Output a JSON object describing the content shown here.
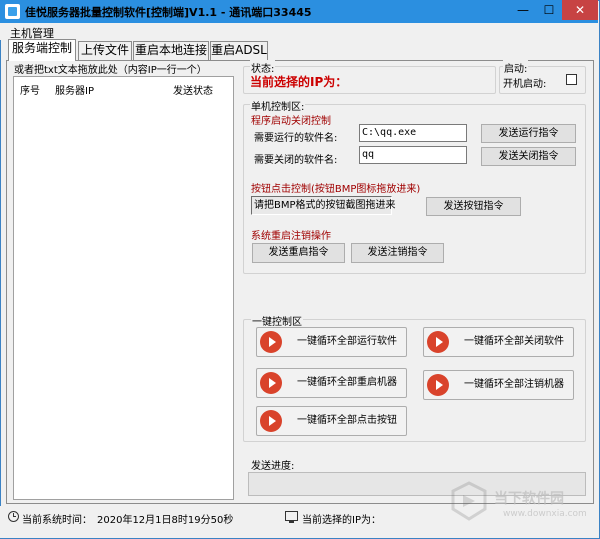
{
  "window": {
    "title": "佳悦服务器批量控制软件[控制端]V1.1 - 通讯端口33445",
    "minimize_glyph": "—",
    "maximize_glyph": "☐",
    "close_glyph": "✕"
  },
  "menu": {
    "items": [
      {
        "label": "主机管理"
      }
    ]
  },
  "tabs": [
    {
      "label": "服务端控制",
      "selected": true
    },
    {
      "label": "上传文件",
      "selected": false
    },
    {
      "label": "重启本地连接",
      "selected": false
    },
    {
      "label": "重启ADSL",
      "selected": false
    }
  ],
  "left_panel": {
    "hint": "或者把txt文本拖放此处（内容IP一行一个）",
    "columns": [
      "序号",
      "服务器IP",
      "发送状态"
    ]
  },
  "status_group": {
    "label": "状态:",
    "current_ip_text": "当前选择的IP为："
  },
  "startup_group": {
    "label": "启动:",
    "autostart_label": "开机启动:",
    "autostart_checked": false
  },
  "single_control": {
    "label": "单机控制区:",
    "program_heading": "程序启动关闭控制",
    "run_label": "需要运行的软件名:",
    "run_value": "C:\\qq.exe",
    "close_label": "需要关闭的软件名:",
    "close_value": "qq",
    "send_run": "发送运行指令",
    "send_close": "发送关闭指令",
    "button_heading": "按钮点击控制(按钮BMP图标拖放进来)",
    "bmp_placeholder": "请把BMP格式的按钮截图拖进来",
    "send_button": "发送按钮指令",
    "reboot_heading": "系统重启注销操作",
    "send_reboot": "发送重启指令",
    "send_logoff": "发送注销指令"
  },
  "onekey": {
    "label": "一键控制区",
    "loop_run": "一键循环全部运行软件",
    "loop_close": "一键循环全部关闭软件",
    "loop_reboot": "一键循环全部重启机器",
    "loop_logoff": "一键循环全部注销机器",
    "loop_click": "一键循环全部点击按钮"
  },
  "progress": {
    "label": "发送进度:",
    "fraction": 0
  },
  "statusbar": {
    "time_label": "当前系统时间：",
    "time_value": "2020年12月1日8时19分50秒",
    "selected_ip_label": "当前选择的IP为："
  },
  "watermark": {
    "brand": "当下软件园",
    "domain": "www.downxia.com"
  },
  "icons": {
    "app": "app-icon",
    "play": "play-icon",
    "clock": "clock-icon",
    "monitor": "monitor-icon"
  },
  "colors": {
    "titlebar": "#2b8fe0",
    "close_button": "#c74343",
    "accent_red": "#c00000",
    "play_button": "#d9432b"
  }
}
